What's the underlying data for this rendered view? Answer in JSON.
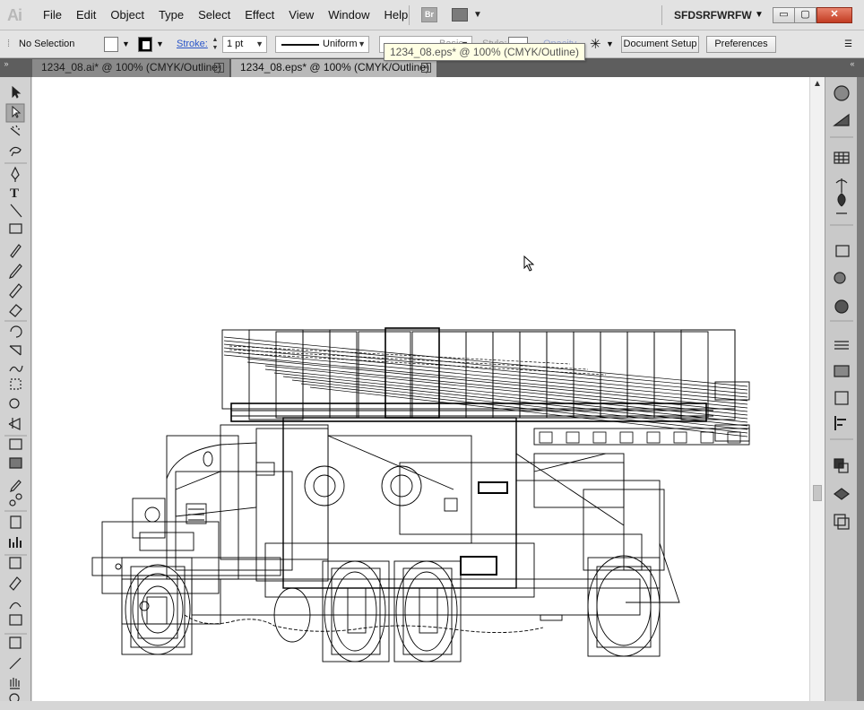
{
  "app": {
    "logo": "Ai",
    "workspace": "SFDSRFWRFW",
    "bridge_label": "Br"
  },
  "menu": [
    "File",
    "Edit",
    "Object",
    "Type",
    "Select",
    "Effect",
    "View",
    "Window",
    "Help"
  ],
  "window_controls": {
    "minimize": "▭",
    "restore": "▢",
    "close": "✕"
  },
  "control_bar": {
    "selection_status": "No Selection",
    "stroke_label": "Stroke:",
    "stroke_weight": "1 pt",
    "stroke_profile": "Uniform",
    "brush": "Basic",
    "style_label": "Style:",
    "opacity_label": "Opacity",
    "document_setup": "Document Setup",
    "preferences": "Preferences"
  },
  "tooltip": "1234_08.eps* @ 100% (CMYK/Outline)",
  "tabs": [
    {
      "label": "1234_08.ai* @ 100% (CMYK/Outline)",
      "active": false
    },
    {
      "label": "1234_08.eps* @ 100% (CMYK/Outline)",
      "active": true
    }
  ],
  "tools": [
    "selection-tool",
    "direct-selection-tool",
    "magic-wand-tool",
    "lasso-tool",
    "pen-tool",
    "type-tool",
    "line-segment-tool",
    "rectangle-tool",
    "paintbrush-tool",
    "pencil-tool",
    "blob-brush-tool",
    "eraser-tool",
    "rotate-tool",
    "scale-tool",
    "warp-tool",
    "free-transform-tool",
    "shape-builder-tool",
    "perspective-grid-tool",
    "mesh-tool",
    "gradient-tool",
    "eyedropper-tool",
    "blend-tool",
    "symbol-sprayer-tool",
    "column-graph-tool",
    "artboard-tool",
    "slice-tool",
    "width-tool",
    "eraser-tool-2",
    "crop-tool",
    "knife-tool",
    "hand-tool",
    "zoom-tool"
  ],
  "dock_panels": [
    "color-panel",
    "color-guide-panel",
    "swatches-panel",
    "brushes-panel",
    "symbols-panel",
    "graphic-styles-panel",
    "appearance-panel",
    "transparency-panel",
    "stroke-panel",
    "gradient-panel",
    "transform-panel",
    "align-panel",
    "pathfinder-panel",
    "layers-panel",
    "artboards-panel"
  ],
  "colors": {
    "close_button": "#c23c22",
    "link": "#2a55c8",
    "tab_active": "#b9b9b9",
    "tab_inactive": "#8a8a8a"
  }
}
